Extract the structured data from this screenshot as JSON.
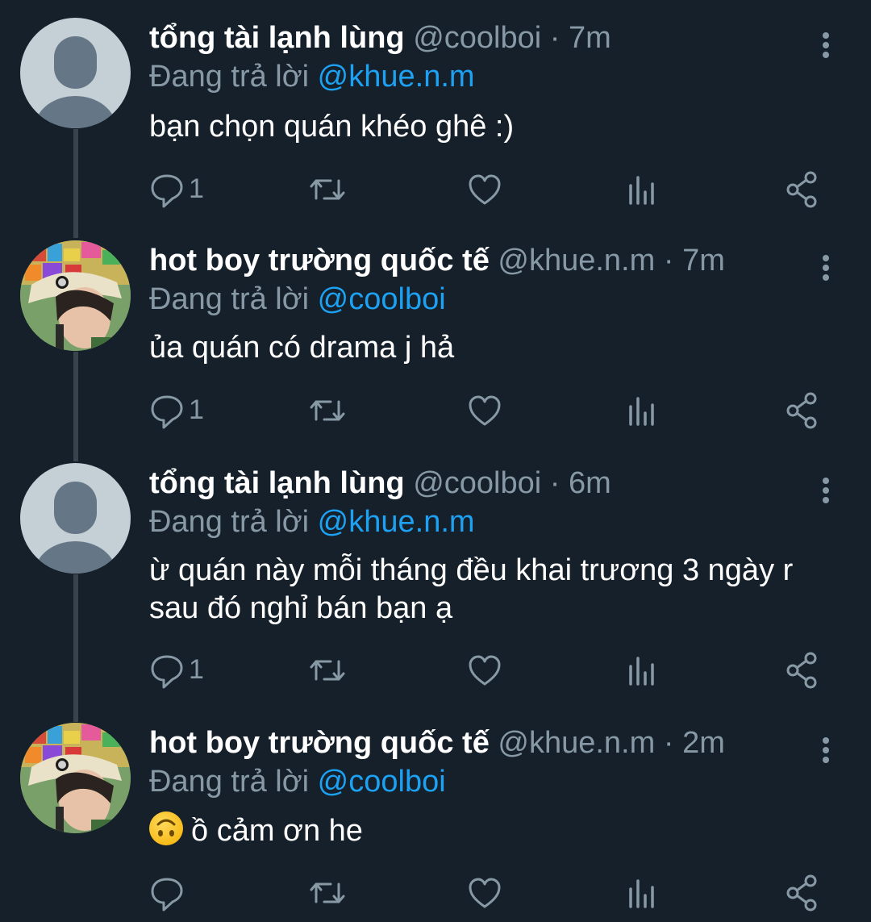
{
  "tweets": [
    {
      "name": "tổng tài lạnh lùng",
      "handle": "@coolboi",
      "time": "7m",
      "reply_prefix": "Đang trả lời ",
      "reply_to": "@khue.n.m",
      "text": "bạn chọn quán khéo ghê :)",
      "reply_count": "1",
      "avatar": "default-avatar"
    },
    {
      "name": "hot boy trường quốc tế",
      "handle": "@khue.n.m",
      "time": "7m",
      "reply_prefix": "Đang trả lời ",
      "reply_to": "@coolboi",
      "text": "ủa quán có drama j hả",
      "reply_count": "1",
      "avatar": "photo-avatar"
    },
    {
      "name": "tổng tài lạnh lùng",
      "handle": "@coolboi",
      "time": "6m",
      "reply_prefix": "Đang trả lời ",
      "reply_to": "@khue.n.m",
      "text_lines": [
        "ừ quán này mỗi tháng đều khai trương 3 ngày r",
        "sau đó nghỉ bán bạn ạ"
      ],
      "reply_count": "1",
      "avatar": "default-avatar"
    },
    {
      "name": "hot boy trường quốc tế",
      "handle": "@khue.n.m",
      "time": "2m",
      "reply_prefix": "Đang trả lời ",
      "reply_to": "@coolboi",
      "emoji": "upside-down-face-emoji",
      "text": "ồ cảm ơn he",
      "reply_count": "",
      "avatar": "photo-avatar"
    }
  ],
  "separator": "·",
  "colors": {
    "background": "#15202b",
    "secondary_text": "#8899a6",
    "accent": "#1da1f2",
    "thread_line": "#38444d"
  },
  "icons": [
    "reply-icon",
    "retweet-icon",
    "like-icon",
    "analytics-icon",
    "share-icon",
    "more-icon"
  ]
}
